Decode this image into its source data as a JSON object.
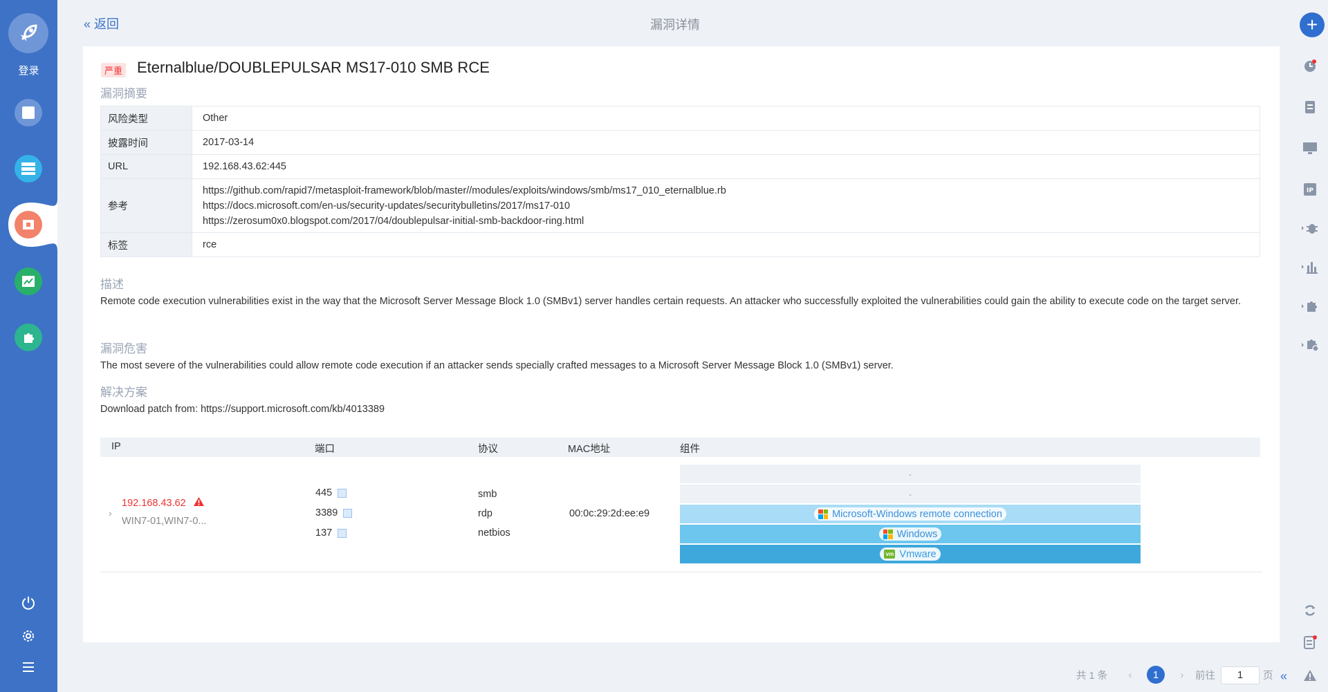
{
  "sidebar": {
    "login_label": "登录"
  },
  "header": {
    "back_label": "返回",
    "title": "漏洞详情"
  },
  "vuln": {
    "severity": "严重",
    "title": "Eternalblue/DOUBLEPULSAR MS17-010 SMB RCE",
    "summary_label": "漏洞摘要",
    "fields": {
      "risk_type_label": "风险类型",
      "risk_type": "Other",
      "disclosed_label": "披露时间",
      "disclosed": "2017-03-14",
      "url_label": "URL",
      "url": "192.168.43.62:445",
      "ref_label": "参考",
      "refs": [
        "https://github.com/rapid7/metasploit-framework/blob/master//modules/exploits/windows/smb/ms17_010_eternalblue.rb",
        "https://docs.microsoft.com/en-us/security-updates/securitybulletins/2017/ms17-010",
        "https://zerosum0x0.blogspot.com/2017/04/doublepulsar-initial-smb-backdoor-ring.html"
      ],
      "tag_label": "标签",
      "tag": "rce"
    },
    "desc_label": "描述",
    "desc": "Remote code execution vulnerabilities exist in the way that the Microsoft Server Message Block 1.0 (SMBv1) server handles certain requests. An attacker who successfully exploited the vulnerabilities could gain the ability to execute code on the target server.",
    "impact_label": "漏洞危害",
    "impact": "The most severe of the vulnerabilities could allow remote code execution if an attacker sends specially crafted messages to a Microsoft Server Message Block 1.0 (SMBv1) server.",
    "solution_label": "解决方案",
    "solution": "Download patch from: https://support.microsoft.com/kb/4013389"
  },
  "assets": {
    "columns": [
      "IP",
      "端口",
      "协议",
      "MAC地址",
      "组件"
    ],
    "row": {
      "ip": "192.168.43.62",
      "hostname": "WIN7-01,WIN7-0...",
      "ports": [
        "445",
        "3389",
        "137"
      ],
      "protocols": [
        "smb",
        "rdp",
        "netbios"
      ],
      "mac": "00:0c:29:2d:ee:e9",
      "components": [
        "-",
        "-",
        "Microsoft-Windows remote connection",
        "Windows",
        "Vmware"
      ]
    }
  },
  "pagination": {
    "total": "共 1 条",
    "current": "1",
    "goto_label": "前往",
    "goto_value": "1",
    "page_suffix": "页"
  },
  "colors": {
    "sidebar": "#3d72c6",
    "accent": "#2f6fd0",
    "danger": "#e33333"
  }
}
